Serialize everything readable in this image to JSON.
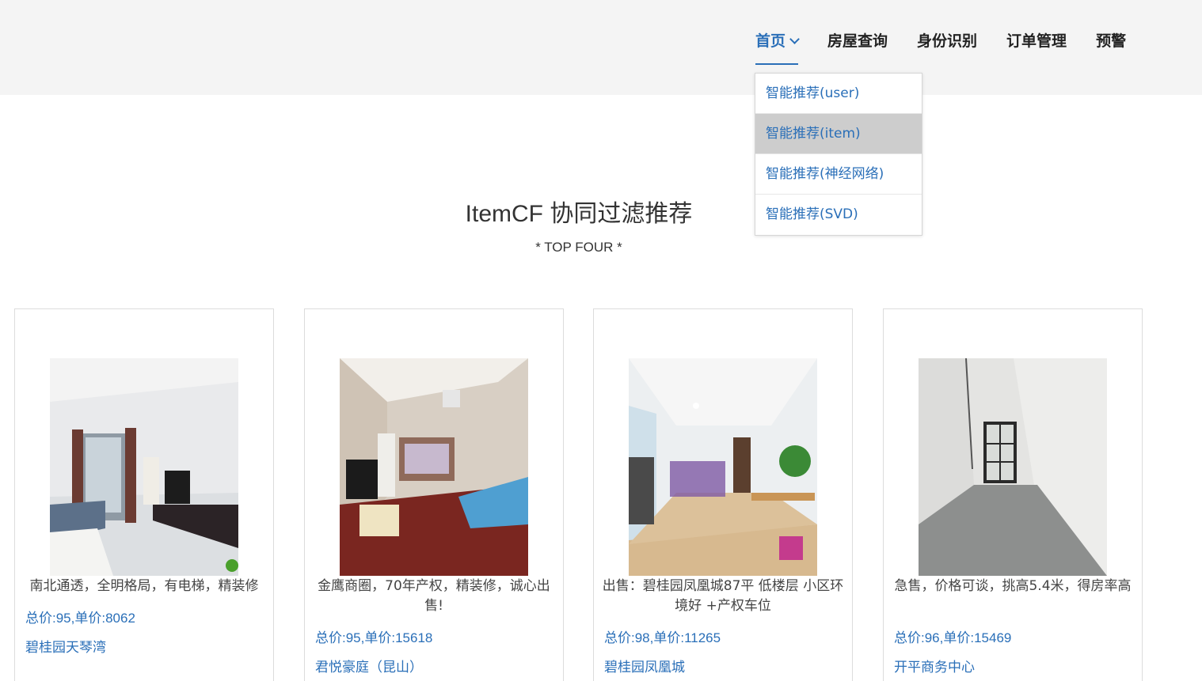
{
  "nav": {
    "items": [
      {
        "label": "首页",
        "active": true
      },
      {
        "label": "房屋查询"
      },
      {
        "label": "身份识别"
      },
      {
        "label": "订单管理"
      },
      {
        "label": "预警"
      }
    ],
    "dropdown": [
      {
        "label": "智能推荐(user)"
      },
      {
        "label": "智能推荐(item)",
        "hovered": true
      },
      {
        "label": "智能推荐(神经网络)"
      },
      {
        "label": "智能推荐(SVD)"
      }
    ]
  },
  "heading": {
    "title": "ItemCF 协同过滤推荐",
    "subtitle": "* TOP FOUR *"
  },
  "cards": [
    {
      "desc": "南北通透，全明格局，有电梯，精装修",
      "price": "总价:95,单价:8062",
      "community": "碧桂园天琴湾"
    },
    {
      "desc": "金鹰商圈，70年产权，精装修，诚心出售!",
      "price": "总价:95,单价:15618",
      "community": "君悦豪庭（昆山）"
    },
    {
      "desc": "出售：碧桂园凤凰城87平 低楼层 小区环境好 +产权车位",
      "price": "总价:98,单价:11265",
      "community": "碧桂园凤凰城"
    },
    {
      "desc": "急售，价格可谈，挑高5.4米，得房率高",
      "price": "总价:96,单价:15469",
      "community": "开平商务中心"
    }
  ],
  "colors": {
    "accent": "#2a6fb8",
    "topbar": "#f4f4f4",
    "hover": "#cdcdcd"
  }
}
